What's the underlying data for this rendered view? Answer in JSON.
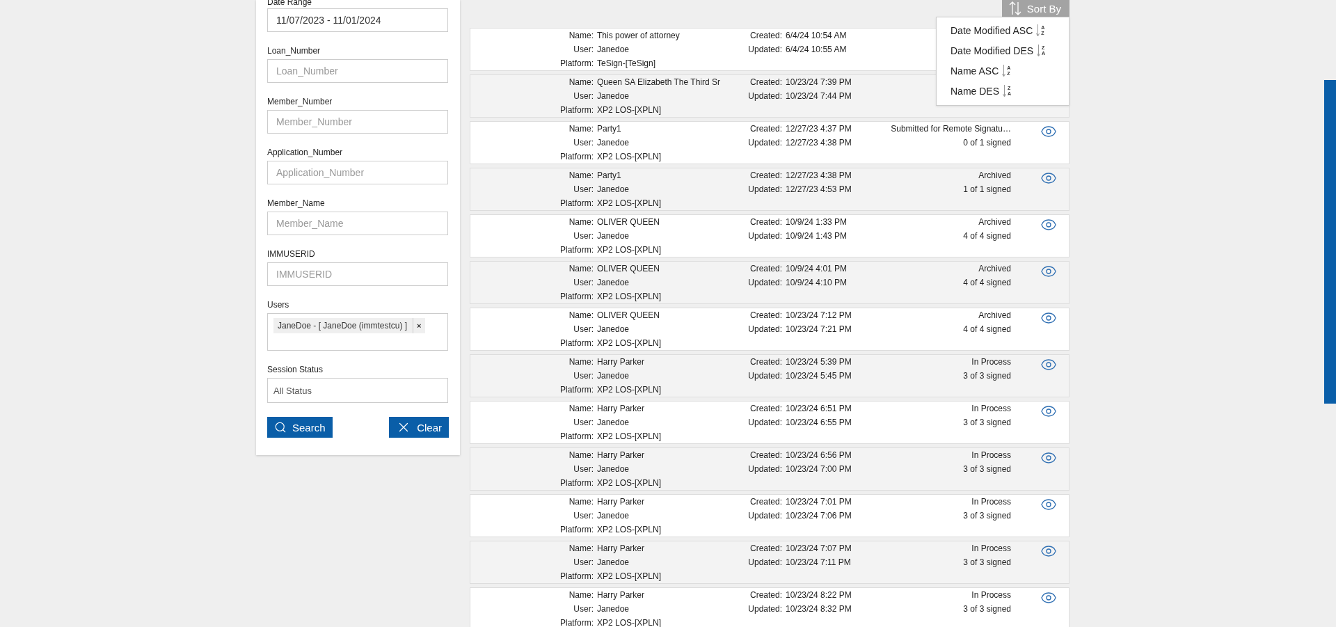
{
  "filters": {
    "date_range": {
      "label": "Date Range",
      "value": "11/07/2023 - 11/01/2024"
    },
    "text_fields": [
      {
        "label": "Loan_Number",
        "placeholder": "Loan_Number"
      },
      {
        "label": "Member_Number",
        "placeholder": "Member_Number"
      },
      {
        "label": "Application_Number",
        "placeholder": "Application_Number"
      },
      {
        "label": "Member_Name",
        "placeholder": "Member_Name"
      },
      {
        "label": "IMMUSERID",
        "placeholder": "IMMUSERID"
      }
    ],
    "users": {
      "label": "Users",
      "chips": [
        {
          "text": "JaneDoe - [ JaneDoe (immtestcu) ]",
          "remove": "×"
        }
      ]
    },
    "session_status": {
      "label": "Session Status",
      "value": "All Status"
    },
    "buttons": [
      {
        "kind": "search",
        "label": "Search"
      },
      {
        "kind": "clear",
        "label": "Clear"
      }
    ]
  },
  "sort": {
    "label": "Sort By",
    "expanded": true,
    "options": [
      {
        "label": "Date Modified ASC",
        "letters": [
          "A",
          "Z"
        ]
      },
      {
        "label": "Date Modified DES",
        "letters": [
          "Z",
          "A"
        ]
      },
      {
        "label": "Name ASC",
        "letters": [
          "A",
          "Z"
        ]
      },
      {
        "label": "Name DES",
        "letters": [
          "Z",
          "A"
        ]
      }
    ]
  },
  "sessions": [
    {
      "name_label": "Name:",
      "name": "This power of attorney",
      "user_label": "User:",
      "user": "Janedoe",
      "platform_label": "Platform:",
      "platform": "TeSign-[TeSign]",
      "created_label": "Created:",
      "created": "6/4/24 10:54 AM",
      "updated_label": "Updated:",
      "updated": "6/4/24 10:55 AM"
    },
    {
      "name_label": "Name:",
      "name": "Queen SA Elizabeth The Third Sr",
      "user_label": "User:",
      "user": "Janedoe",
      "platform_label": "Platform:",
      "platform": "XP2 LOS-[XPLN]",
      "created_label": "Created:",
      "created": "10/23/24 7:39 PM",
      "updated_label": "Updated:",
      "updated": "10/23/24 7:44 PM"
    },
    {
      "name_label": "Name:",
      "name": "Party1",
      "user_label": "User:",
      "user": "Janedoe",
      "platform_label": "Platform:",
      "platform": "XP2 LOS-[XPLN]",
      "created_label": "Created:",
      "created": "12/27/23 4:37 PM",
      "updated_label": "Updated:",
      "updated": "12/27/23 4:38 PM",
      "status": "Submitted for Remote Signatu…",
      "signed": "0 of 1 signed",
      "viewable": true
    },
    {
      "name_label": "Name:",
      "name": "Party1",
      "user_label": "User:",
      "user": "Janedoe",
      "platform_label": "Platform:",
      "platform": "XP2 LOS-[XPLN]",
      "created_label": "Created:",
      "created": "12/27/23 4:38 PM",
      "updated_label": "Updated:",
      "updated": "12/27/23 4:53 PM",
      "status": "Archived",
      "signed": "1 of 1 signed",
      "viewable": true
    },
    {
      "name_label": "Name:",
      "name": "OLIVER QUEEN",
      "user_label": "User:",
      "user": "Janedoe",
      "platform_label": "Platform:",
      "platform": "XP2 LOS-[XPLN]",
      "created_label": "Created:",
      "created": "10/9/24 1:33 PM",
      "updated_label": "Updated:",
      "updated": "10/9/24 1:43 PM",
      "status": "Archived",
      "signed": "4 of 4 signed",
      "viewable": true
    },
    {
      "name_label": "Name:",
      "name": "OLIVER QUEEN",
      "user_label": "User:",
      "user": "Janedoe",
      "platform_label": "Platform:",
      "platform": "XP2 LOS-[XPLN]",
      "created_label": "Created:",
      "created": "10/9/24 4:01 PM",
      "updated_label": "Updated:",
      "updated": "10/9/24 4:10 PM",
      "status": "Archived",
      "signed": "4 of 4 signed",
      "viewable": true
    },
    {
      "name_label": "Name:",
      "name": "OLIVER QUEEN",
      "user_label": "User:",
      "user": "Janedoe",
      "platform_label": "Platform:",
      "platform": "XP2 LOS-[XPLN]",
      "created_label": "Created:",
      "created": "10/23/24 7:12 PM",
      "updated_label": "Updated:",
      "updated": "10/23/24 7:21 PM",
      "status": "Archived",
      "signed": "4 of 4 signed",
      "viewable": true
    },
    {
      "name_label": "Name:",
      "name": "Harry Parker",
      "user_label": "User:",
      "user": "Janedoe",
      "platform_label": "Platform:",
      "platform": "XP2 LOS-[XPLN]",
      "created_label": "Created:",
      "created": "10/23/24 5:39 PM",
      "updated_label": "Updated:",
      "updated": "10/23/24 5:45 PM",
      "status": "In Process",
      "signed": "3 of 3 signed",
      "viewable": true
    },
    {
      "name_label": "Name:",
      "name": "Harry Parker",
      "user_label": "User:",
      "user": "Janedoe",
      "platform_label": "Platform:",
      "platform": "XP2 LOS-[XPLN]",
      "created_label": "Created:",
      "created": "10/23/24 6:51 PM",
      "updated_label": "Updated:",
      "updated": "10/23/24 6:55 PM",
      "status": "In Process",
      "signed": "3 of 3 signed",
      "viewable": true
    },
    {
      "name_label": "Name:",
      "name": "Harry Parker",
      "user_label": "User:",
      "user": "Janedoe",
      "platform_label": "Platform:",
      "platform": "XP2 LOS-[XPLN]",
      "created_label": "Created:",
      "created": "10/23/24 6:56 PM",
      "updated_label": "Updated:",
      "updated": "10/23/24 7:00 PM",
      "status": "In Process",
      "signed": "3 of 3 signed",
      "viewable": true
    },
    {
      "name_label": "Name:",
      "name": "Harry Parker",
      "user_label": "User:",
      "user": "Janedoe",
      "platform_label": "Platform:",
      "platform": "XP2 LOS-[XPLN]",
      "created_label": "Created:",
      "created": "10/23/24 7:01 PM",
      "updated_label": "Updated:",
      "updated": "10/23/24 7:06 PM",
      "status": "In Process",
      "signed": "3 of 3 signed",
      "viewable": true
    },
    {
      "name_label": "Name:",
      "name": "Harry Parker",
      "user_label": "User:",
      "user": "Janedoe",
      "platform_label": "Platform:",
      "platform": "XP2 LOS-[XPLN]",
      "created_label": "Created:",
      "created": "10/23/24 7:07 PM",
      "updated_label": "Updated:",
      "updated": "10/23/24 7:11 PM",
      "status": "In Process",
      "signed": "3 of 3 signed",
      "viewable": true
    },
    {
      "name_label": "Name:",
      "name": "Harry Parker",
      "user_label": "User:",
      "user": "Janedoe",
      "platform_label": "Platform:",
      "platform": "XP2 LOS-[XPLN]",
      "created_label": "Created:",
      "created": "10/23/24 8:22 PM",
      "updated_label": "Updated:",
      "updated": "10/23/24 8:32 PM",
      "status": "In Process",
      "signed": "3 of 3 signed",
      "viewable": true
    }
  ]
}
